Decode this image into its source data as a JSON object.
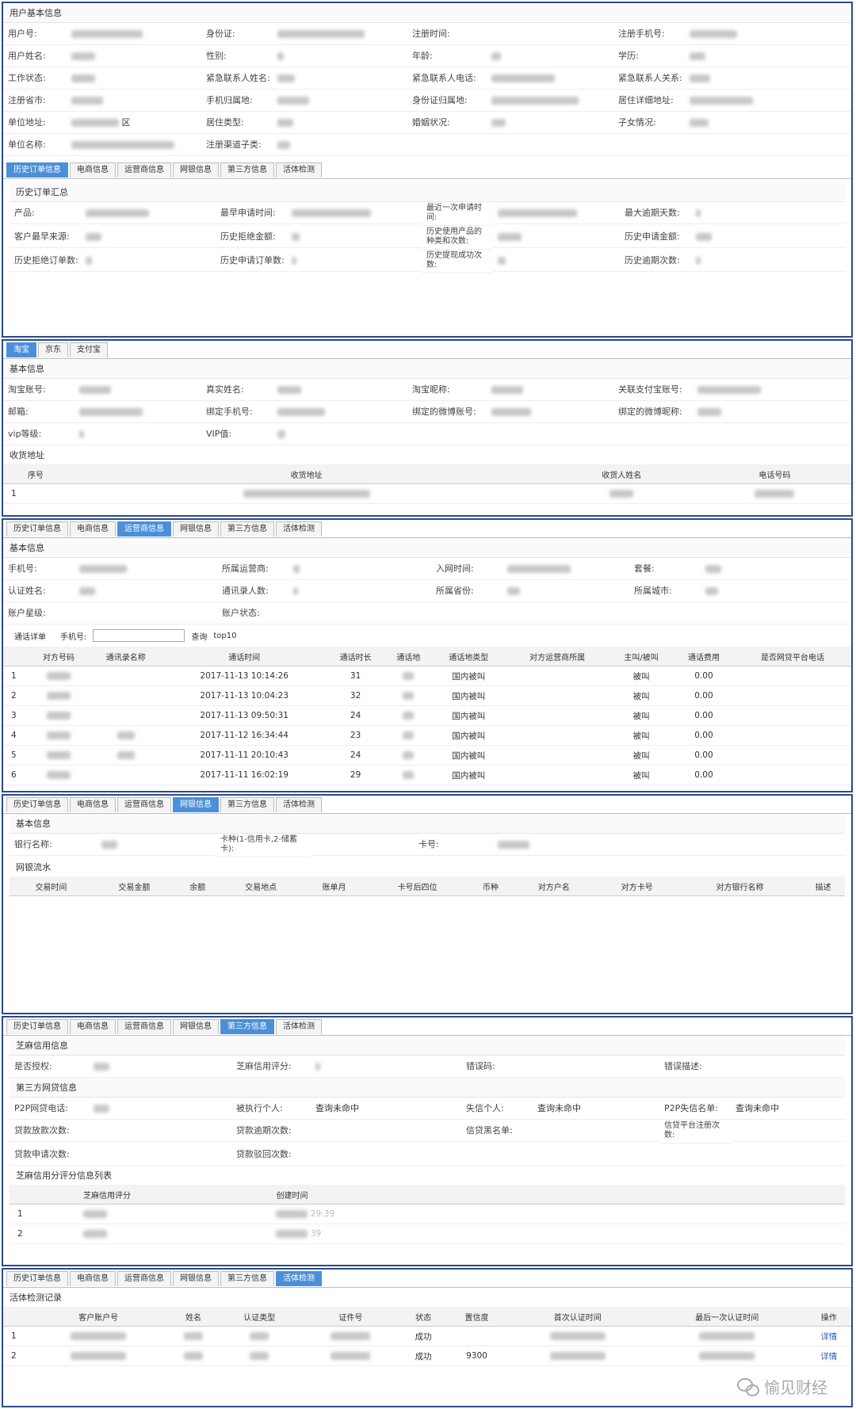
{
  "user_info": {
    "title": "用户基本信息",
    "labels": [
      "用户号:",
      "身份证:",
      "注册时间:",
      "注册手机号:",
      "用户姓名:",
      "性别:",
      "年龄:",
      "学历:",
      "工作状态:",
      "紧急联系人姓名:",
      "紧急联系人电话:",
      "紧急联系人关系:",
      "注册省市:",
      "手机归属地:",
      "身份证归属地:",
      "居住详细地址:",
      "单位地址:",
      "居住类型:",
      "婚姻状况:",
      "子女情况:",
      "单位名称:",
      "注册渠道子类:"
    ],
    "unit_addr_suffix": "区"
  },
  "tabs": [
    "历史订单信息",
    "电商信息",
    "运营商信息",
    "网银信息",
    "第三方信息",
    "活体检测"
  ],
  "history": {
    "title": "历史订单汇总",
    "labels": [
      "产品:",
      "最早申请时间:",
      "最近一次申请时间:",
      "最大逾期天数:",
      "客户最早来源:",
      "历史拒绝金额:",
      "历史使用产品的种类和次数:",
      "历史申请金额:",
      "历史拒绝订单数:",
      "历史申请订单数:",
      "历史提现成功次数:",
      "历史逾期次数:"
    ]
  },
  "ecommerce": {
    "tabs": [
      "淘宝",
      "京东",
      "支付宝"
    ],
    "title": "基本信息",
    "labels": [
      "淘宝账号:",
      "真实姓名:",
      "淘宝昵称:",
      "关联支付宝账号:",
      "邮箱:",
      "绑定手机号:",
      "绑定的微博账号:",
      "绑定的微博昵称:",
      "vip等级:",
      "VIP值:"
    ],
    "address_title": "收货地址",
    "address_headers": [
      "序号",
      "收货地址",
      "收货人姓名",
      "电话号码"
    ],
    "address_rows": [
      [
        "1"
      ]
    ]
  },
  "operator": {
    "title": "基本信息",
    "labels": [
      "手机号:",
      "所属运营商:",
      "入网时间:",
      "套餐:",
      "认证姓名:",
      "通讯录人数:",
      "所属省份:",
      "所属城市:",
      "账户星级:",
      "账户状态:"
    ],
    "call_title": "通话详单",
    "phone_label": "手机号:",
    "query_label": "查询",
    "top_label": "top10",
    "headers": [
      "对方号码",
      "通讯录名称",
      "通话时间",
      "通话时长",
      "通话地",
      "通话地类型",
      "对方运营商所属",
      "主叫/被叫",
      "通话费用",
      "是否网贷平台电话"
    ],
    "rows": [
      {
        "idx": "1",
        "time": "2017-11-13 10:14:26",
        "dur": "31",
        "type": "国内被叫",
        "dir": "被叫",
        "fee": "0.00"
      },
      {
        "idx": "2",
        "time": "2017-11-13 10:04:23",
        "dur": "32",
        "type": "国内被叫",
        "dir": "被叫",
        "fee": "0.00"
      },
      {
        "idx": "3",
        "time": "2017-11-13 09:50:31",
        "dur": "24",
        "type": "国内被叫",
        "dir": "被叫",
        "fee": "0.00"
      },
      {
        "idx": "4",
        "time": "2017-11-12 16:34:44",
        "dur": "23",
        "type": "国内被叫",
        "dir": "被叫",
        "fee": "0.00"
      },
      {
        "idx": "5",
        "time": "2017-11-11 20:10:43",
        "dur": "24",
        "type": "国内被叫",
        "dir": "被叫",
        "fee": "0.00"
      },
      {
        "idx": "6",
        "time": "2017-11-11 16:02:19",
        "dur": "29",
        "type": "国内被叫",
        "dir": "被叫",
        "fee": "0.00"
      }
    ]
  },
  "bank": {
    "title": "基本信息",
    "labels": [
      "银行名称:",
      "卡种(1-信用卡,2-储蓄卡):",
      "卡号:"
    ],
    "flow_title": "网银流水",
    "headers": [
      "交易时间",
      "交易金额",
      "余额",
      "交易地点",
      "账单月",
      "卡号后四位",
      "币种",
      "对方户名",
      "对方卡号",
      "对方银行名称",
      "描述"
    ]
  },
  "third": {
    "zhima_title": "芝麻信用信息",
    "zhima_labels": [
      "是否授权:",
      "芝麻信用评分:",
      "错误码:",
      "错误描述:"
    ],
    "p2p_title": "第三方网贷信息",
    "p2p_labels": [
      "P2P网贷电话:",
      "被执行个人:",
      "失信个人:",
      "P2P失信名单:",
      "贷款放款次数:",
      "贷款逾期次数:",
      "信贷黑名单:",
      "信贷平台注册次数:",
      "贷款申请次数:",
      "贷款驳回次数:"
    ],
    "not_hit": "查询未命中",
    "score_list_title": "芝麻信用分评分信息列表",
    "score_headers": [
      "芝麻信用评分",
      "创建时间"
    ],
    "score_rows": [
      {
        "idx": "1",
        "time_suffix": "29:39"
      },
      {
        "idx": "2",
        "time_suffix": "39"
      }
    ]
  },
  "liveness": {
    "title": "活体检测记录",
    "headers": [
      "客户账户号",
      "姓名",
      "认证类型",
      "证件号",
      "状态",
      "置信度",
      "首次认证时间",
      "最后一次认证时间",
      "操作"
    ],
    "rows": [
      {
        "idx": "1",
        "status": "成功",
        "score": "",
        "action": "详情"
      },
      {
        "idx": "2",
        "status": "成功",
        "score": "9300",
        "action": "详情"
      }
    ]
  },
  "watermark": "愉见财经"
}
